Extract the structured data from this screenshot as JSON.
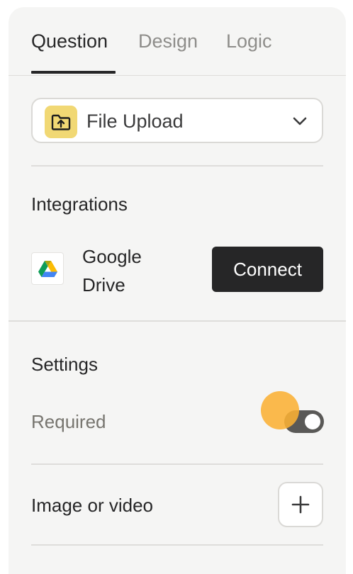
{
  "tabs": [
    {
      "label": "Question",
      "active": true
    },
    {
      "label": "Design",
      "active": false
    },
    {
      "label": "Logic",
      "active": false
    }
  ],
  "question_type": {
    "label": "File Upload",
    "icon": "folder-upload-icon",
    "badge_color": "#f1d874"
  },
  "integrations": {
    "title": "Integrations",
    "items": [
      {
        "name": "Google Drive",
        "icon": "google-drive-icon",
        "action_label": "Connect"
      }
    ]
  },
  "settings": {
    "title": "Settings",
    "required": {
      "label": "Required",
      "on": true
    }
  },
  "media": {
    "label": "Image or video",
    "icon": "plus-icon"
  },
  "colors": {
    "panel_bg": "#f5f5f4",
    "text": "#262627",
    "muted_text": "#8e8d8a",
    "primary_button": "#262627",
    "cursor_highlight": "#fbb034"
  }
}
